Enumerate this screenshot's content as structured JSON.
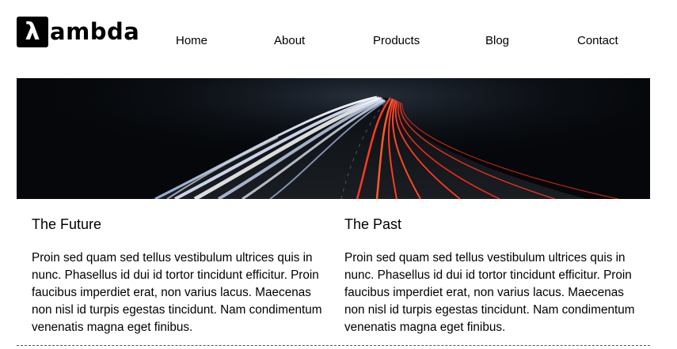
{
  "brand": {
    "logo_glyph": "λ",
    "logo_text": "ambda"
  },
  "nav": {
    "items": [
      "Home",
      "About",
      "Products",
      "Blog",
      "Contact"
    ]
  },
  "hero": {
    "image_icon": "highway-light-trails-image"
  },
  "sections": [
    {
      "title": "The Future",
      "body": "Proin sed quam sed tellus vestibulum ultrices quis in nunc. Phasellus id dui id tortor tincidunt efficitur. Proin faucibus imperdiet erat, non varius lacus. Maecenas non nisl id turpis egestas tincidunt. Nam condimentum venenatis magna eget finibus."
    },
    {
      "title": "The Past",
      "body": "Proin sed quam sed tellus vestibulum ultrices quis in nunc. Phasellus id dui id tortor tincidunt efficitur. Proin faucibus imperdiet erat, non varius lacus. Maecenas non nisl id turpis egestas tincidunt. Nam condimentum venenatis magna eget finibus."
    }
  ],
  "colors": {
    "background": "#ffffff",
    "text": "#000000",
    "trail_white": "#e8f0ff",
    "trail_red": "#ff3b1f"
  }
}
